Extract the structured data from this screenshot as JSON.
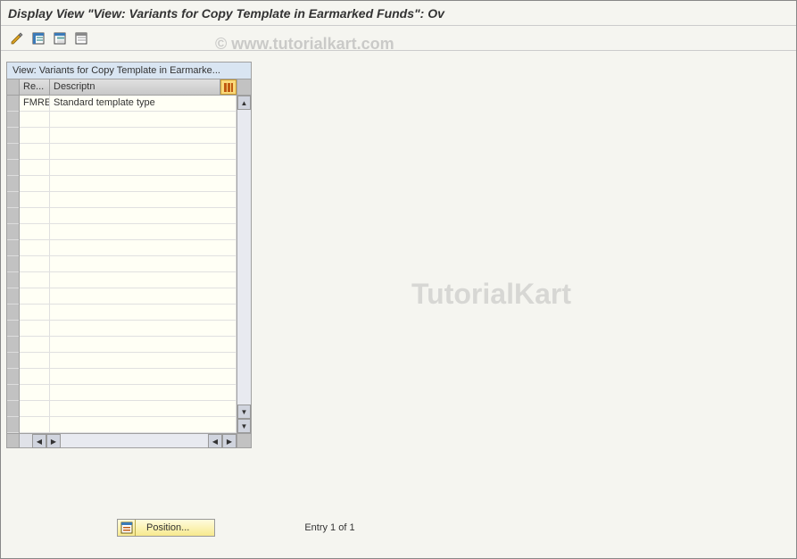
{
  "header": {
    "title": "Display View \"View: Variants for Copy Template in Earmarked Funds\": Ov"
  },
  "watermark": {
    "top": "© www.tutorialkart.com",
    "middle": "TutorialKart"
  },
  "panel": {
    "title": "View: Variants for Copy Template in Earmarke..."
  },
  "columns": {
    "re": "Re...",
    "desc": "Descriptn"
  },
  "rows": [
    {
      "re": "FMRE",
      "desc": "Standard template type"
    }
  ],
  "footer": {
    "position_label": "Position...",
    "entry_text": "Entry 1 of 1"
  },
  "icons": {
    "toggle": "change-display-icon",
    "select_all": "select-all-icon",
    "select_block": "select-block-icon",
    "deselect_all": "deselect-all-icon",
    "config": "configure-columns-icon"
  }
}
